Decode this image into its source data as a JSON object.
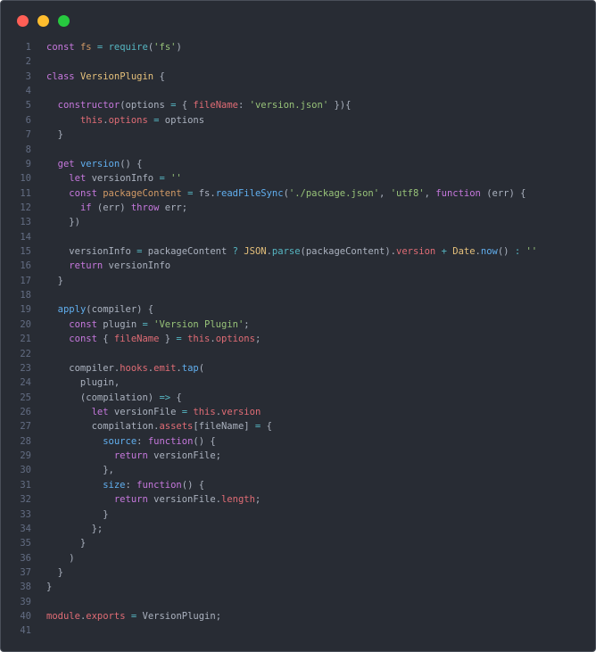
{
  "window_controls": {
    "close_color": "#ff5f56",
    "minimize_color": "#ffbd2e",
    "maximize_color": "#27c93f"
  },
  "code_lines": [
    [
      [
        "k",
        "const"
      ],
      [
        "t",
        " "
      ],
      [
        "v",
        "fs"
      ],
      [
        "t",
        " "
      ],
      [
        "o",
        "="
      ],
      [
        "t",
        " "
      ],
      [
        "b",
        "require"
      ],
      [
        "t",
        "("
      ],
      [
        "s",
        "'fs'"
      ],
      [
        "t",
        ")"
      ]
    ],
    [],
    [
      [
        "k",
        "class"
      ],
      [
        "t",
        " "
      ],
      [
        "c",
        "VersionPlugin"
      ],
      [
        "t",
        " {"
      ]
    ],
    [],
    [
      [
        "t",
        "  "
      ],
      [
        "k",
        "constructor"
      ],
      [
        "t",
        "(options "
      ],
      [
        "o",
        "="
      ],
      [
        "t",
        " { "
      ],
      [
        "p",
        "fileName"
      ],
      [
        "t",
        ": "
      ],
      [
        "s",
        "'version.json'"
      ],
      [
        "t",
        " }){"
      ]
    ],
    [
      [
        "t",
        "      "
      ],
      [
        "p",
        "this"
      ],
      [
        "t",
        "."
      ],
      [
        "p",
        "options"
      ],
      [
        "t",
        " "
      ],
      [
        "o",
        "="
      ],
      [
        "t",
        " options"
      ]
    ],
    [
      [
        "t",
        "  }"
      ]
    ],
    [],
    [
      [
        "t",
        "  "
      ],
      [
        "k",
        "get"
      ],
      [
        "t",
        " "
      ],
      [
        "f",
        "version"
      ],
      [
        "t",
        "() {"
      ]
    ],
    [
      [
        "t",
        "    "
      ],
      [
        "k",
        "let"
      ],
      [
        "t",
        " versionInfo "
      ],
      [
        "o",
        "="
      ],
      [
        "t",
        " "
      ],
      [
        "s",
        "''"
      ]
    ],
    [
      [
        "t",
        "    "
      ],
      [
        "k",
        "const"
      ],
      [
        "t",
        " "
      ],
      [
        "v",
        "packageContent"
      ],
      [
        "t",
        " "
      ],
      [
        "o",
        "="
      ],
      [
        "t",
        " fs."
      ],
      [
        "f",
        "readFileSync"
      ],
      [
        "t",
        "("
      ],
      [
        "s",
        "'./package.json'"
      ],
      [
        "t",
        ", "
      ],
      [
        "s",
        "'utf8'"
      ],
      [
        "t",
        ", "
      ],
      [
        "k",
        "function"
      ],
      [
        "t",
        " (err) {"
      ]
    ],
    [
      [
        "t",
        "      "
      ],
      [
        "k",
        "if"
      ],
      [
        "t",
        " (err) "
      ],
      [
        "k",
        "throw"
      ],
      [
        "t",
        " err;"
      ]
    ],
    [
      [
        "t",
        "    })"
      ]
    ],
    [],
    [
      [
        "t",
        "    versionInfo "
      ],
      [
        "o",
        "="
      ],
      [
        "t",
        " packageContent "
      ],
      [
        "o",
        "?"
      ],
      [
        "t",
        " "
      ],
      [
        "c",
        "JSON"
      ],
      [
        "t",
        "."
      ],
      [
        "b",
        "parse"
      ],
      [
        "t",
        "(packageContent)."
      ],
      [
        "p",
        "version"
      ],
      [
        "t",
        " "
      ],
      [
        "o",
        "+"
      ],
      [
        "t",
        " "
      ],
      [
        "c",
        "Date"
      ],
      [
        "t",
        "."
      ],
      [
        "f",
        "now"
      ],
      [
        "t",
        "() "
      ],
      [
        "o",
        ":"
      ],
      [
        "t",
        " "
      ],
      [
        "s",
        "''"
      ]
    ],
    [
      [
        "t",
        "    "
      ],
      [
        "k",
        "return"
      ],
      [
        "t",
        " versionInfo"
      ]
    ],
    [
      [
        "t",
        "  }"
      ]
    ],
    [],
    [
      [
        "t",
        "  "
      ],
      [
        "f",
        "apply"
      ],
      [
        "t",
        "(compiler) {"
      ]
    ],
    [
      [
        "t",
        "    "
      ],
      [
        "k",
        "const"
      ],
      [
        "t",
        " plugin "
      ],
      [
        "o",
        "="
      ],
      [
        "t",
        " "
      ],
      [
        "s",
        "'Version Plugin'"
      ],
      [
        "t",
        ";"
      ]
    ],
    [
      [
        "t",
        "    "
      ],
      [
        "k",
        "const"
      ],
      [
        "t",
        " { "
      ],
      [
        "p",
        "fileName"
      ],
      [
        "t",
        " } "
      ],
      [
        "o",
        "="
      ],
      [
        "t",
        " "
      ],
      [
        "p",
        "this"
      ],
      [
        "t",
        "."
      ],
      [
        "p",
        "options"
      ],
      [
        "t",
        ";"
      ]
    ],
    [],
    [
      [
        "t",
        "    compiler."
      ],
      [
        "p",
        "hooks"
      ],
      [
        "t",
        "."
      ],
      [
        "p",
        "emit"
      ],
      [
        "t",
        "."
      ],
      [
        "f",
        "tap"
      ],
      [
        "t",
        "("
      ]
    ],
    [
      [
        "t",
        "      plugin,"
      ]
    ],
    [
      [
        "t",
        "      (compilation) "
      ],
      [
        "o",
        "=>"
      ],
      [
        "t",
        " {"
      ]
    ],
    [
      [
        "t",
        "        "
      ],
      [
        "k",
        "let"
      ],
      [
        "t",
        " versionFile "
      ],
      [
        "o",
        "="
      ],
      [
        "t",
        " "
      ],
      [
        "p",
        "this"
      ],
      [
        "t",
        "."
      ],
      [
        "p",
        "version"
      ]
    ],
    [
      [
        "t",
        "        compilation."
      ],
      [
        "p",
        "assets"
      ],
      [
        "t",
        "[fileName] "
      ],
      [
        "o",
        "="
      ],
      [
        "t",
        " {"
      ]
    ],
    [
      [
        "t",
        "          "
      ],
      [
        "f",
        "source"
      ],
      [
        "t",
        ": "
      ],
      [
        "k",
        "function"
      ],
      [
        "t",
        "() {"
      ]
    ],
    [
      [
        "t",
        "            "
      ],
      [
        "k",
        "return"
      ],
      [
        "t",
        " versionFile;"
      ]
    ],
    [
      [
        "t",
        "          },"
      ]
    ],
    [
      [
        "t",
        "          "
      ],
      [
        "f",
        "size"
      ],
      [
        "t",
        ": "
      ],
      [
        "k",
        "function"
      ],
      [
        "t",
        "() {"
      ]
    ],
    [
      [
        "t",
        "            "
      ],
      [
        "k",
        "return"
      ],
      [
        "t",
        " versionFile."
      ],
      [
        "p",
        "length"
      ],
      [
        "t",
        ";"
      ]
    ],
    [
      [
        "t",
        "          }"
      ]
    ],
    [
      [
        "t",
        "        };"
      ]
    ],
    [
      [
        "t",
        "      }"
      ]
    ],
    [
      [
        "t",
        "    )"
      ]
    ],
    [
      [
        "t",
        "  }"
      ]
    ],
    [
      [
        "t",
        "}"
      ]
    ],
    [],
    [
      [
        "p",
        "module"
      ],
      [
        "t",
        "."
      ],
      [
        "p",
        "exports"
      ],
      [
        "t",
        " "
      ],
      [
        "o",
        "="
      ],
      [
        "t",
        " VersionPlugin;"
      ]
    ],
    []
  ]
}
